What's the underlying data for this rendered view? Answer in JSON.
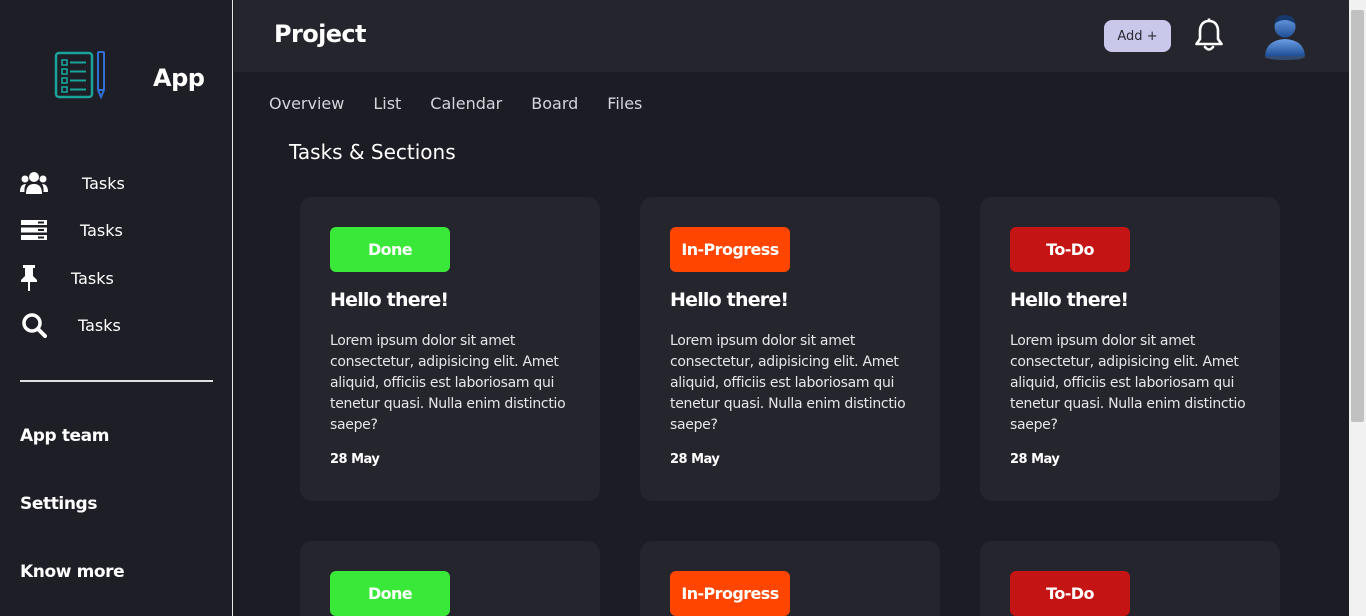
{
  "sidebar": {
    "app_name": "App",
    "nav": [
      {
        "label": "Tasks",
        "icon": "users-icon"
      },
      {
        "label": "Tasks",
        "icon": "server-icon"
      },
      {
        "label": "Tasks",
        "icon": "pin-icon"
      },
      {
        "label": "Tasks",
        "icon": "search-icon"
      }
    ],
    "links": [
      "App team",
      "Settings",
      "Know more"
    ]
  },
  "header": {
    "title": "Project",
    "add_label": "Add +"
  },
  "tabs": [
    "Overview",
    "List",
    "Calendar",
    "Board",
    "Files"
  ],
  "section_title": "Tasks & Sections",
  "cards": [
    {
      "status": "Done",
      "title": "Hello there!",
      "text": "Lorem ipsum dolor sit amet consectetur, adipisicing elit. Amet aliquid, officiis est laboriosam qui tenetur quasi. Nulla enim distinctio saepe?",
      "date": "28 May"
    },
    {
      "status": "In-Progress",
      "title": "Hello there!",
      "text": "Lorem ipsum dolor sit amet consectetur, adipisicing elit. Amet aliquid, officiis est laboriosam qui tenetur quasi. Nulla enim distinctio saepe?",
      "date": "28 May"
    },
    {
      "status": "To-Do",
      "title": "Hello there!",
      "text": "Lorem ipsum dolor sit amet consectetur, adipisicing elit. Amet aliquid, officiis est laboriosam qui tenetur quasi. Nulla enim distinctio saepe?",
      "date": "28 May"
    },
    {
      "status": "Done"
    },
    {
      "status": "In-Progress"
    },
    {
      "status": "To-Do"
    }
  ],
  "colors": {
    "done": "#3ae83a",
    "in_progress": "#ff4500",
    "todo": "#c41414",
    "background": "#1c1c24",
    "panel": "#25252d",
    "add_button": "#c9c8ea"
  }
}
